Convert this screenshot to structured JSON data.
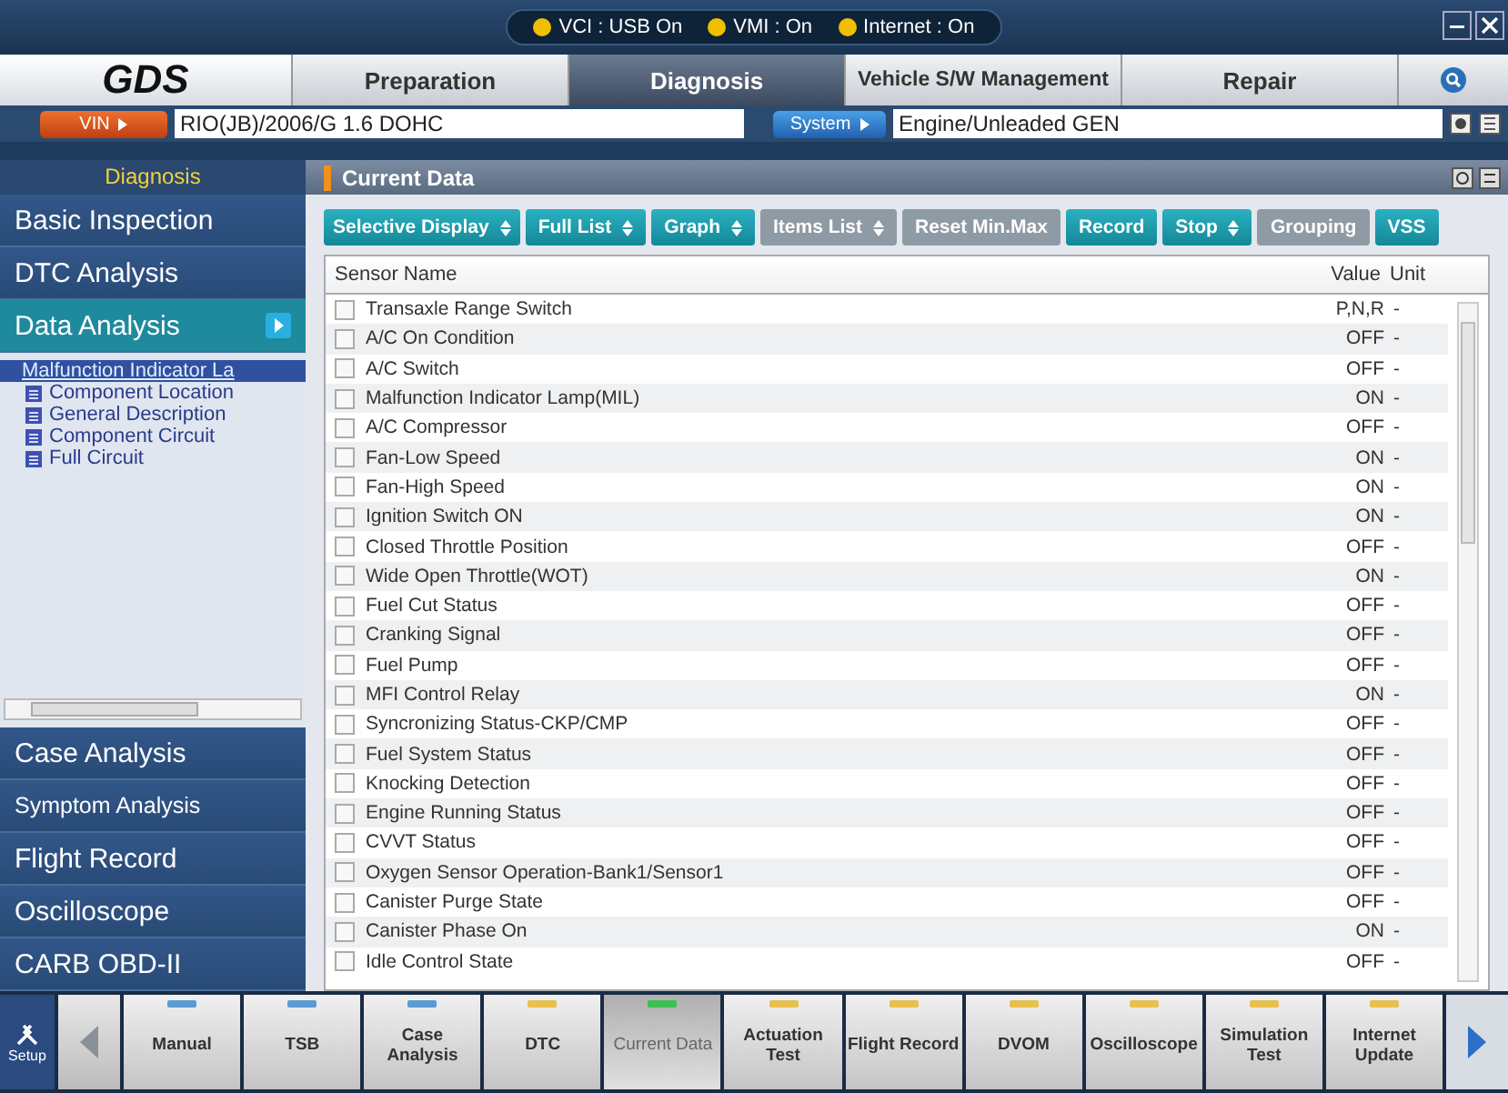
{
  "status_indicators": [
    {
      "label": "VCI : USB On",
      "color": "#f0c000"
    },
    {
      "label": "VMI : On",
      "color": "#f0c000"
    },
    {
      "label": "Internet : On",
      "color": "#f0c000"
    }
  ],
  "logo": "GDS",
  "nav_tabs": [
    {
      "label": "Preparation",
      "selected": false
    },
    {
      "label": "Diagnosis",
      "selected": true
    },
    {
      "label": "Vehicle S/W Management",
      "selected": false
    },
    {
      "label": "Repair",
      "selected": false
    }
  ],
  "vin": {
    "label": "VIN",
    "value": "RIO(JB)/2006/G 1.6 DOHC"
  },
  "system": {
    "label": "System",
    "value": "Engine/Unleaded GEN"
  },
  "sidebar": {
    "title": "Diagnosis",
    "items_top": [
      {
        "label": "Basic Inspection",
        "selected": false
      },
      {
        "label": "DTC Analysis",
        "selected": false
      },
      {
        "label": "Data Analysis",
        "selected": true
      }
    ],
    "tree": {
      "label": "Malfunction  Indicator  La",
      "selected": true,
      "children": [
        {
          "label": "Component Location",
          "selected": false
        },
        {
          "label": "General Description",
          "selected": false
        },
        {
          "label": "Component Circuit",
          "selected": false
        },
        {
          "label": "Full Circuit",
          "selected": false
        }
      ]
    },
    "items_bottom": [
      {
        "label": "Case Analysis",
        "selected": false
      },
      {
        "label": "Symptom Analysis",
        "selected": false
      },
      {
        "label": "Flight Record",
        "selected": false
      },
      {
        "label": "Oscilloscope",
        "selected": false
      },
      {
        "label": "CARB OBD-II",
        "selected": false
      }
    ]
  },
  "panel": {
    "title": "Current Data"
  },
  "toolbar": [
    {
      "label": "Selective Display",
      "dropdown": true,
      "disabled": false
    },
    {
      "label": "Full List",
      "dropdown": true,
      "disabled": false
    },
    {
      "label": "Graph",
      "dropdown": true,
      "disabled": false
    },
    {
      "label": "Items List",
      "dropdown": true,
      "disabled": true
    },
    {
      "label": "Reset Min.Max",
      "dropdown": false,
      "disabled": true
    },
    {
      "label": "Record",
      "dropdown": false,
      "disabled": false
    },
    {
      "label": "Stop",
      "dropdown": true,
      "disabled": false
    },
    {
      "label": "Grouping",
      "dropdown": false,
      "disabled": true
    },
    {
      "label": "VSS",
      "dropdown": false,
      "disabled": false
    }
  ],
  "table": {
    "columns": [
      "Sensor Name",
      "Value",
      "Unit"
    ],
    "rows": [
      {
        "name": "Transaxle Range Switch",
        "value": "P,N,R",
        "unit": "-",
        "checked": false
      },
      {
        "name": "A/C On Condition",
        "value": "OFF",
        "unit": "-",
        "checked": false
      },
      {
        "name": "A/C Switch",
        "value": "OFF",
        "unit": "-",
        "checked": false
      },
      {
        "name": "Malfunction Indicator Lamp(MIL)",
        "value": "ON",
        "unit": "-",
        "checked": false
      },
      {
        "name": "A/C Compressor",
        "value": "OFF",
        "unit": "-",
        "checked": false
      },
      {
        "name": "Fan-Low Speed",
        "value": "ON",
        "unit": "-",
        "checked": false
      },
      {
        "name": "Fan-High Speed",
        "value": "ON",
        "unit": "-",
        "checked": false
      },
      {
        "name": "Ignition Switch ON",
        "value": "ON",
        "unit": "-",
        "checked": false
      },
      {
        "name": "Closed Throttle Position",
        "value": "OFF",
        "unit": "-",
        "checked": false
      },
      {
        "name": "Wide Open Throttle(WOT)",
        "value": "ON",
        "unit": "-",
        "checked": false
      },
      {
        "name": "Fuel Cut Status",
        "value": "OFF",
        "unit": "-",
        "checked": false
      },
      {
        "name": "Cranking Signal",
        "value": "OFF",
        "unit": "-",
        "checked": false
      },
      {
        "name": "Fuel Pump",
        "value": "OFF",
        "unit": "-",
        "checked": false
      },
      {
        "name": "MFI Control Relay",
        "value": "ON",
        "unit": "-",
        "checked": false
      },
      {
        "name": "Syncronizing Status-CKP/CMP",
        "value": "OFF",
        "unit": "-",
        "checked": false
      },
      {
        "name": "Fuel System Status",
        "value": "OFF",
        "unit": "-",
        "checked": false
      },
      {
        "name": "Knocking Detection",
        "value": "OFF",
        "unit": "-",
        "checked": false
      },
      {
        "name": "Engine Running Status",
        "value": "OFF",
        "unit": "-",
        "checked": false
      },
      {
        "name": "CVVT Status",
        "value": "OFF",
        "unit": "-",
        "checked": false
      },
      {
        "name": "Oxygen Sensor Operation-Bank1/Sensor1",
        "value": "OFF",
        "unit": "-",
        "checked": false
      },
      {
        "name": "Canister Purge State",
        "value": "OFF",
        "unit": "-",
        "checked": false
      },
      {
        "name": "Canister Phase On",
        "value": "ON",
        "unit": "-",
        "checked": false
      },
      {
        "name": "Idle Control State",
        "value": "OFF",
        "unit": "-",
        "checked": false
      }
    ]
  },
  "setup": {
    "label": "Setup"
  },
  "bottom_tabs": [
    {
      "label": "Manual",
      "color": "#5b9bd5",
      "selected": false
    },
    {
      "label": "TSB",
      "color": "#5b9bd5",
      "selected": false
    },
    {
      "label": "Case Analysis",
      "color": "#5b9bd5",
      "selected": false
    },
    {
      "label": "DTC",
      "color": "#e8c050",
      "selected": false
    },
    {
      "label": "Current Data",
      "color": "#3ec050",
      "selected": true
    },
    {
      "label": "Actuation Test",
      "color": "#e8c050",
      "selected": false
    },
    {
      "label": "Flight Record",
      "color": "#e8c050",
      "selected": false
    },
    {
      "label": "DVOM",
      "color": "#e8c050",
      "selected": false
    },
    {
      "label": "Oscilloscope",
      "color": "#e8c050",
      "selected": false
    },
    {
      "label": "Simulation Test",
      "color": "#e8c050",
      "selected": false
    },
    {
      "label": "Internet Update",
      "color": "#e8c050",
      "selected": false
    }
  ]
}
